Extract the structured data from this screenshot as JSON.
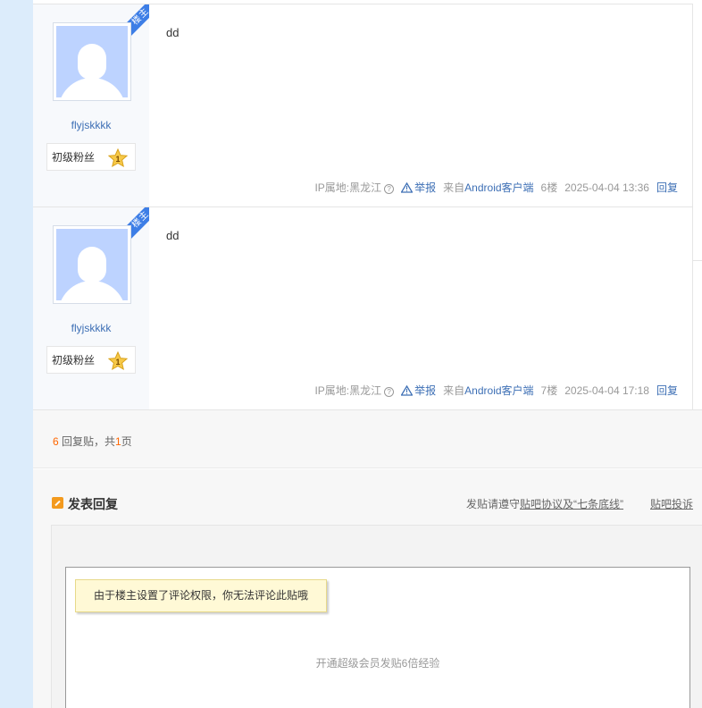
{
  "posts": [
    {
      "lz_label": "楼主",
      "username": "flyjskkkk",
      "badge_text": "初级粉丝",
      "badge_level": "1",
      "content": "dd",
      "ip_location": "IP属地:黑龙江",
      "report_label": "举报",
      "from_prefix": "来自",
      "from_client": "Android客户端",
      "floor": "6楼",
      "time": "2025-04-04 13:36",
      "reply_label": "回复"
    },
    {
      "lz_label": "楼主",
      "username": "flyjskkkk",
      "badge_text": "初级粉丝",
      "badge_level": "1",
      "content": "dd",
      "ip_location": "IP属地:黑龙江",
      "report_label": "举报",
      "from_prefix": "来自",
      "from_client": "Android客户端",
      "floor": "7楼",
      "time": "2025-04-04 17:18",
      "reply_label": "回复"
    }
  ],
  "pager": {
    "reply_count": "6",
    "reply_suffix": " 回复贴，共",
    "page_count": "1",
    "page_suffix": "页"
  },
  "reply": {
    "title": "发表回复",
    "rules_prefix": "发贴请遵守",
    "rules_link": "贴吧协议及“七条底线”",
    "complain_link": "贴吧投诉",
    "permission_tip": "由于楼主设置了评论权限，你无法评论此贴哦",
    "vip_tip": "开通超级会员发贴6倍经验"
  },
  "colors": {
    "page_bg": "#dcecfb",
    "link_blue": "#3d6fb5",
    "ribbon_blue": "#3d7ee6",
    "highlight_orange": "#ff6600",
    "avatar_bg": "#bdd3ff",
    "tip_bg": "#fff9d6"
  },
  "icons": {
    "question": "question-circle-icon",
    "report": "warning-triangle-icon",
    "star": "star-badge-icon",
    "edit": "edit-pencil-icon"
  }
}
